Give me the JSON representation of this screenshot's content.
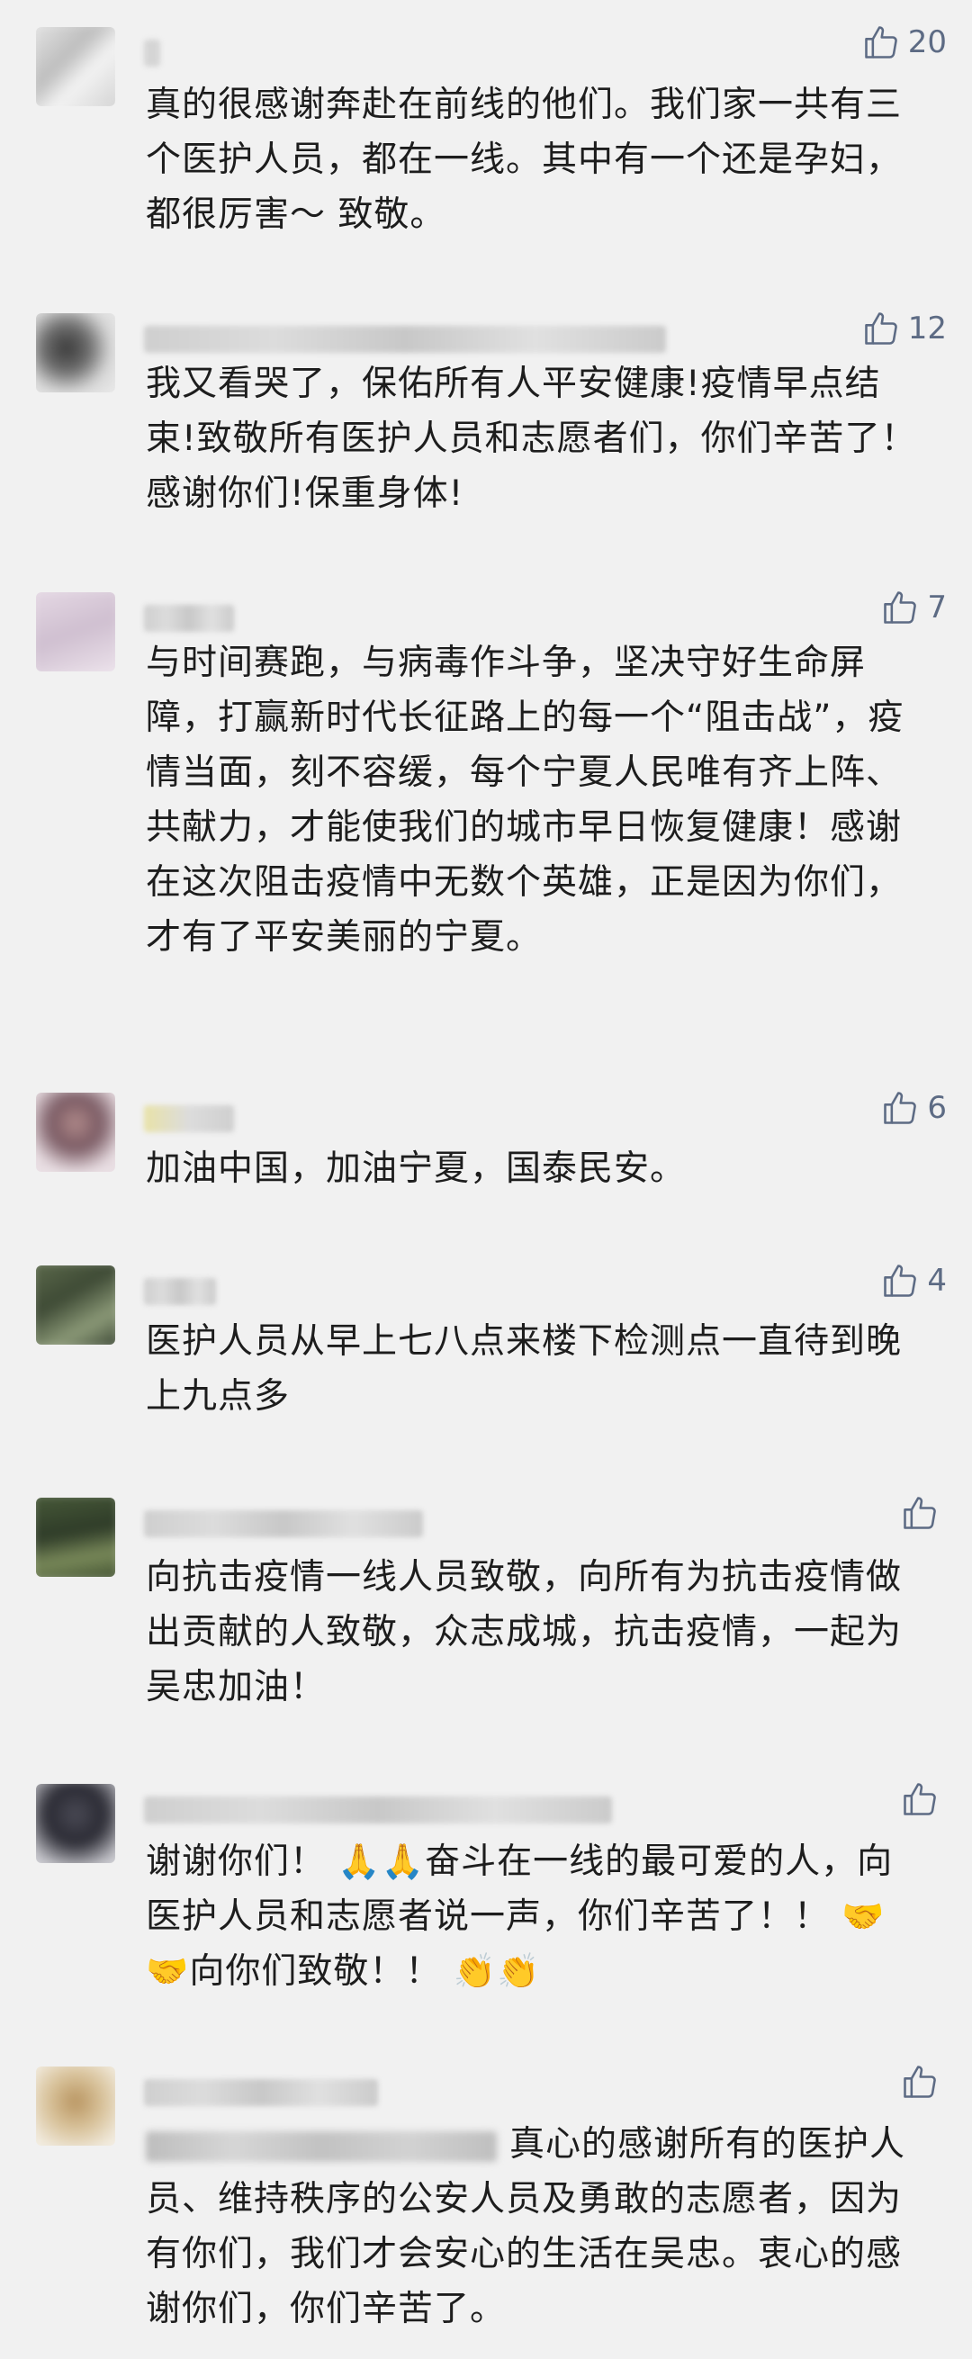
{
  "comments": [
    {
      "likes": "20",
      "text": "真的很感谢奔赴在前线的他们。我们家一共有三个医护人员，都在一线。其中有一个还是孕妇，都很厉害～ 致敬。"
    },
    {
      "likes": "12",
      "text": "我又看哭了，保佑所有人平安健康!疫情早点结束!致敬所有医护人员和志愿者们，你们辛苦了！感谢你们!保重身体!"
    },
    {
      "likes": "7",
      "text": "与时间赛跑，与病毒作斗争，坚决守好生命屏障，打赢新时代长征路上的每一个“阻击战”，疫情当面，刻不容缓，每个宁夏人民唯有齐上阵、共献力，才能使我们的城市早日恢复健康！感谢在这次阻击疫情中无数个英雄，正是因为你们，才有了平安美丽的宁夏。"
    },
    {
      "likes": "6",
      "text": "加油中国，加油宁夏，国泰民安。"
    },
    {
      "likes": "4",
      "text": "医护人员从早上七八点来楼下检测点一直待到晚上九点多"
    },
    {
      "likes": "",
      "text": "向抗击疫情一线人员致敬，向所有为抗击疫情做出贡献的人致敬，众志成城，抗击疫情，一起为吴忠加油！"
    },
    {
      "likes": "",
      "text_a": "谢谢你们！",
      "emoji_a": "🙏🙏",
      "text_b": "奋斗在一线的最可爱的人，向医护人员和志愿者说一声，你们辛苦了！！",
      "emoji_b": "🤝🤝",
      "text_c": "向你们致敬！！",
      "emoji_c": "👏👏"
    },
    {
      "likes": "",
      "text": "真心的感谢所有的医护人员、维持秩序的公安人员及勇敢的志愿者，因为有你们，我们才会安心的生活在吴忠。衷心的感谢你们，你们辛苦了。"
    }
  ],
  "icons": {
    "like": "thumbs-up-icon"
  },
  "colors": {
    "background": "#f1f1f1",
    "like": "#5d6b84",
    "text": "#1d1d1d"
  }
}
